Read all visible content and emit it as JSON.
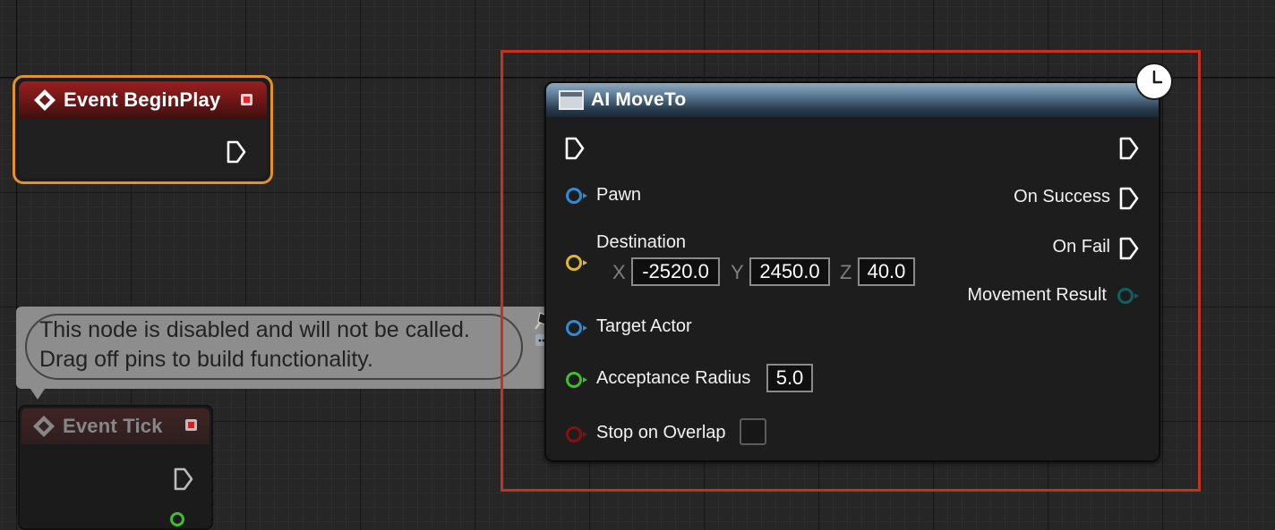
{
  "nodes": {
    "begin_play": {
      "title": "Event BeginPlay"
    },
    "event_tick": {
      "title": "Event Tick"
    },
    "ai_moveto": {
      "title": "AI MoveTo",
      "pins": {
        "pawn": "Pawn",
        "destination": "Destination",
        "target_actor": "Target Actor",
        "acceptance_radius": "Acceptance Radius",
        "stop_on_overlap": "Stop on Overlap",
        "on_success": "On Success",
        "on_fail": "On Fail",
        "movement_result": "Movement Result"
      },
      "destination": {
        "x_label": "X",
        "x": "-2520.0",
        "y_label": "Y",
        "y": "2450.0",
        "z_label": "Z",
        "z": "40.0"
      },
      "acceptance_radius_value": "5.0",
      "stop_on_overlap_checked": false
    }
  },
  "comment": {
    "line1": "This node is disabled and will not be called.",
    "line2": "Drag off pins to build functionality."
  },
  "colors": {
    "object_pin": "#2f8ad8",
    "vector_pin": "#e0b72b",
    "float_pin": "#3fc02b",
    "bool_pin": "#8a0e0e",
    "struct_pin": "#0f6060",
    "selection": "#c4321e",
    "begin_play_outline": "#e3922a"
  }
}
